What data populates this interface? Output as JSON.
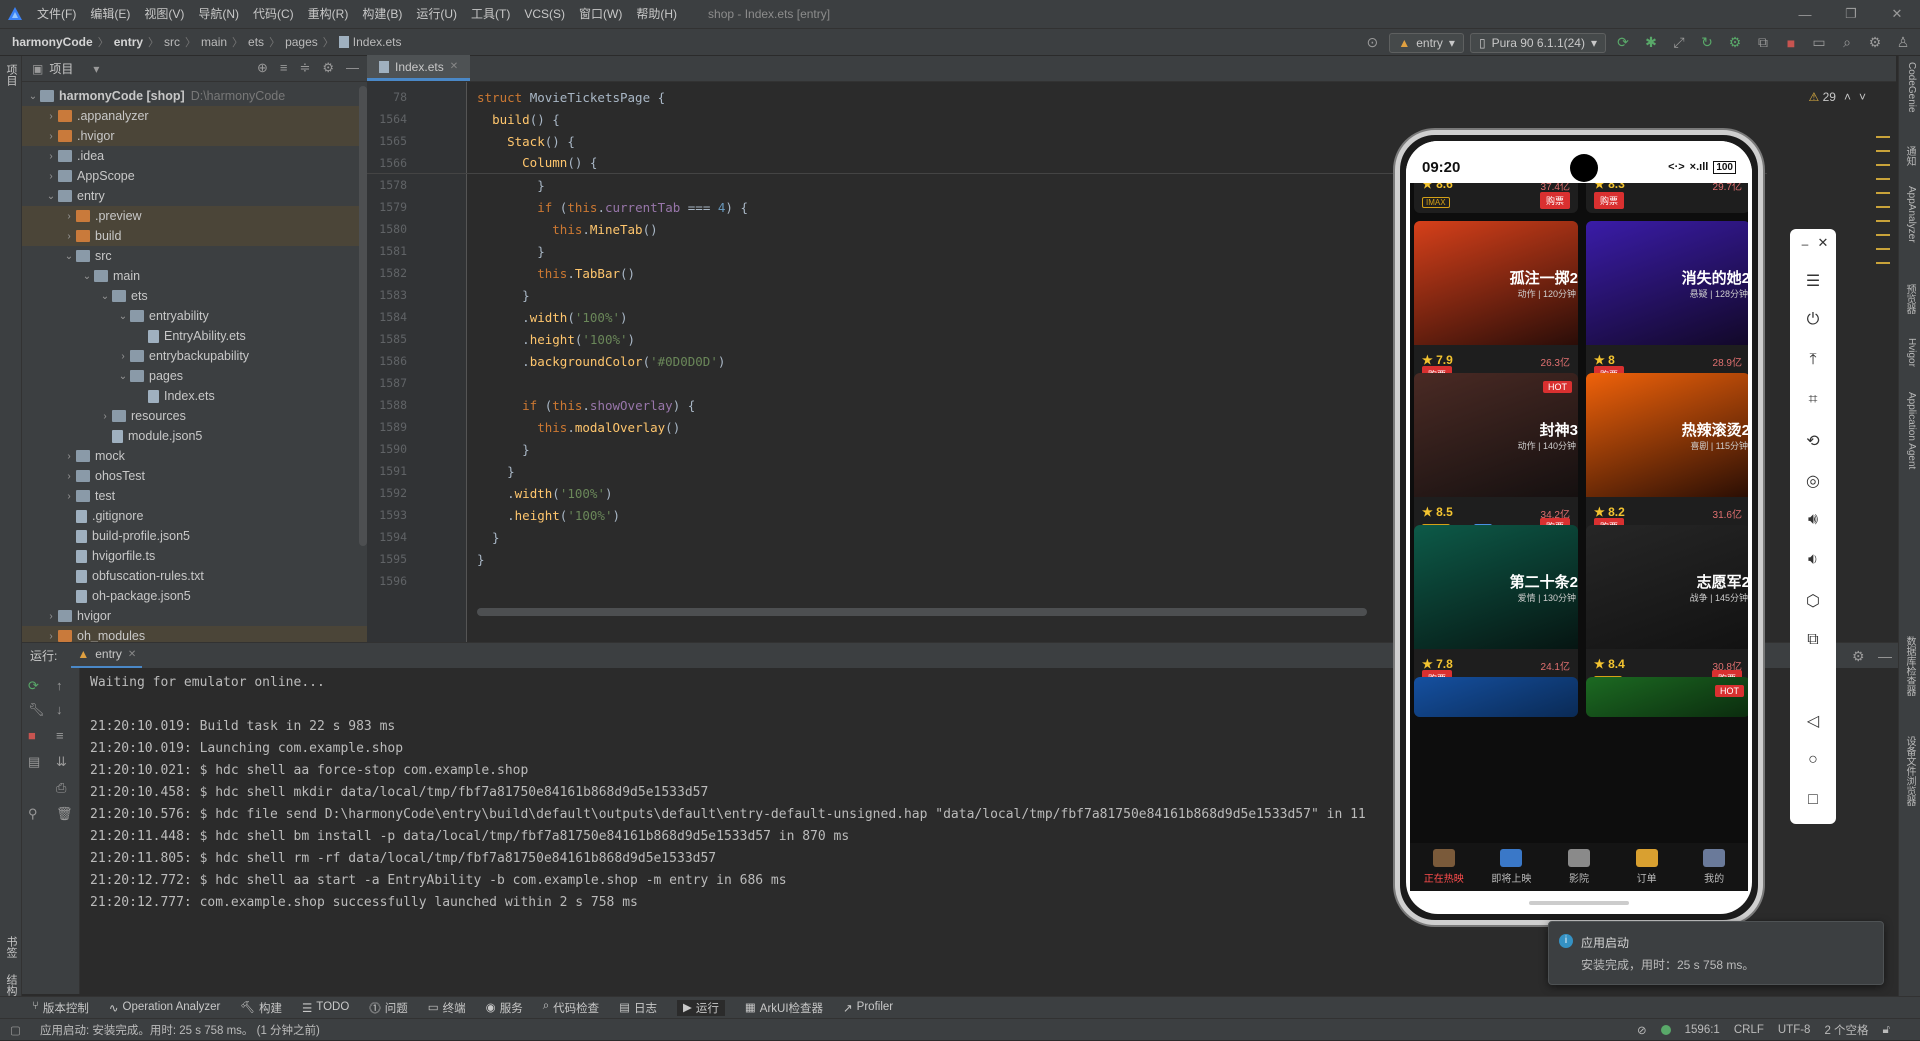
{
  "menubar": {
    "items": [
      "文件(F)",
      "编辑(E)",
      "视图(V)",
      "导航(N)",
      "代码(C)",
      "重构(R)",
      "构建(B)",
      "运行(U)",
      "工具(T)",
      "VCS(S)",
      "窗口(W)",
      "帮助(H)"
    ],
    "window_title": "shop - Index.ets [entry]"
  },
  "navbar": {
    "crumbs": [
      "harmonyCode",
      "entry",
      "src",
      "main",
      "ets",
      "pages",
      "Index.ets"
    ],
    "run_config": "entry",
    "device": "Pura 90 6.1.1(24)"
  },
  "left_strip": {
    "project_label": "项目",
    "bookmarks_label": "书签",
    "structure_label": "结构"
  },
  "right_strip": [
    "CodeGenie",
    "通知",
    "AppAnalyzer",
    "预览器",
    "Hvigor",
    "Application Agent",
    "数据库检查器",
    "设备文件浏览器"
  ],
  "project": {
    "title": "项目",
    "tree": [
      {
        "indent": 0,
        "arrow": "⌄",
        "type": "module",
        "label": "harmonyCode [shop]",
        "sub": "D:\\harmonyCode",
        "excluded": false
      },
      {
        "indent": 1,
        "arrow": "›",
        "type": "folder-orange",
        "label": ".appanalyzer",
        "excluded": true
      },
      {
        "indent": 1,
        "arrow": "›",
        "type": "folder-orange",
        "label": ".hvigor",
        "excluded": true
      },
      {
        "indent": 1,
        "arrow": "›",
        "type": "folder",
        "label": ".idea",
        "excluded": false
      },
      {
        "indent": 1,
        "arrow": "›",
        "type": "folder",
        "label": "AppScope",
        "excluded": false
      },
      {
        "indent": 1,
        "arrow": "⌄",
        "type": "folder",
        "label": "entry",
        "excluded": false
      },
      {
        "indent": 2,
        "arrow": "›",
        "type": "folder-orange",
        "label": ".preview",
        "excluded": true
      },
      {
        "indent": 2,
        "arrow": "›",
        "type": "folder-orange",
        "label": "build",
        "excluded": true
      },
      {
        "indent": 2,
        "arrow": "⌄",
        "type": "folder",
        "label": "src",
        "excluded": false
      },
      {
        "indent": 3,
        "arrow": "⌄",
        "type": "folder",
        "label": "main",
        "excluded": false
      },
      {
        "indent": 4,
        "arrow": "⌄",
        "type": "folder",
        "label": "ets",
        "excluded": false
      },
      {
        "indent": 5,
        "arrow": "⌄",
        "type": "folder",
        "label": "entryability",
        "excluded": false
      },
      {
        "indent": 6,
        "arrow": "",
        "type": "file",
        "label": "EntryAbility.ets",
        "excluded": false
      },
      {
        "indent": 5,
        "arrow": "›",
        "type": "folder",
        "label": "entrybackupability",
        "excluded": false
      },
      {
        "indent": 5,
        "arrow": "⌄",
        "type": "folder",
        "label": "pages",
        "excluded": false
      },
      {
        "indent": 6,
        "arrow": "",
        "type": "file",
        "label": "Index.ets",
        "excluded": false
      },
      {
        "indent": 4,
        "arrow": "›",
        "type": "folder",
        "label": "resources",
        "excluded": false
      },
      {
        "indent": 4,
        "arrow": "",
        "type": "file",
        "label": "module.json5",
        "excluded": false
      },
      {
        "indent": 2,
        "arrow": "›",
        "type": "folder",
        "label": "mock",
        "excluded": false
      },
      {
        "indent": 2,
        "arrow": "›",
        "type": "folder",
        "label": "ohosTest",
        "excluded": false
      },
      {
        "indent": 2,
        "arrow": "›",
        "type": "folder",
        "label": "test",
        "excluded": false
      },
      {
        "indent": 2,
        "arrow": "",
        "type": "file",
        "label": ".gitignore",
        "excluded": false
      },
      {
        "indent": 2,
        "arrow": "",
        "type": "file",
        "label": "build-profile.json5",
        "excluded": false
      },
      {
        "indent": 2,
        "arrow": "",
        "type": "file",
        "label": "hvigorfile.ts",
        "excluded": false
      },
      {
        "indent": 2,
        "arrow": "",
        "type": "file",
        "label": "obfuscation-rules.txt",
        "excluded": false
      },
      {
        "indent": 2,
        "arrow": "",
        "type": "file",
        "label": "oh-package.json5",
        "excluded": false
      },
      {
        "indent": 1,
        "arrow": "›",
        "type": "folder",
        "label": "hvigor",
        "excluded": false
      },
      {
        "indent": 1,
        "arrow": "›",
        "type": "folder-orange",
        "label": "oh_modules",
        "excluded": true
      }
    ]
  },
  "editor": {
    "tab": "Index.ets",
    "warnings": "29",
    "lines": [
      {
        "n": "78",
        "html": "<span class=\"kw\">struct</span> <span class=\"cls\">MovieTicketsPage</span> {",
        "sticky": false
      },
      {
        "n": "1564",
        "html": "  <span class=\"fn\">build</span>() {",
        "sticky": false
      },
      {
        "n": "1565",
        "html": "    <span class=\"fn\">Stack</span>() {",
        "sticky": false
      },
      {
        "n": "1566",
        "html": "      <span class=\"fn\">Column</span>() {",
        "sticky": true
      },
      {
        "n": "1578",
        "html": "        }",
        "sticky": false
      },
      {
        "n": "1579",
        "html": "        <span class=\"kw\">if</span> (<span class=\"kw\">this</span>.<span class=\"purple\">currentTab</span> === <span class=\"num\">4</span>) {",
        "sticky": false
      },
      {
        "n": "1580",
        "html": "          <span class=\"kw\">this</span>.<span class=\"fn\">MineTab</span>()",
        "sticky": false
      },
      {
        "n": "1581",
        "html": "        }",
        "sticky": false
      },
      {
        "n": "1582",
        "html": "        <span class=\"kw\">this</span>.<span class=\"fn\">TabBar</span>()",
        "sticky": false
      },
      {
        "n": "1583",
        "html": "      }",
        "sticky": false
      },
      {
        "n": "1584",
        "html": "      .<span class=\"fn\">width</span>(<span class=\"str\">'100%'</span>)",
        "sticky": false
      },
      {
        "n": "1585",
        "html": "      .<span class=\"fn\">height</span>(<span class=\"str\">'100%'</span>)",
        "sticky": false
      },
      {
        "n": "1586",
        "html": "      .<span class=\"fn\">backgroundColor</span>(<span class=\"str\">'#0D0D0D'</span>)",
        "sticky": false
      },
      {
        "n": "1587",
        "html": "",
        "sticky": false
      },
      {
        "n": "1588",
        "html": "      <span class=\"kw\">if</span> (<span class=\"kw\">this</span>.<span class=\"purple\">showOverlay</span>) {",
        "sticky": false
      },
      {
        "n": "1589",
        "html": "        <span class=\"kw\">this</span>.<span class=\"fn\">modalOverlay</span>()",
        "sticky": false
      },
      {
        "n": "1590",
        "html": "      }",
        "sticky": false
      },
      {
        "n": "1591",
        "html": "    }",
        "sticky": false
      },
      {
        "n": "1592",
        "html": "    .<span class=\"fn\">width</span>(<span class=\"str\">'100%'</span>)",
        "sticky": false
      },
      {
        "n": "1593",
        "html": "    .<span class=\"fn\">height</span>(<span class=\"str\">'100%'</span>)",
        "sticky": false
      },
      {
        "n": "1594",
        "html": "  }",
        "sticky": false
      },
      {
        "n": "1595",
        "html": "}",
        "sticky": false
      },
      {
        "n": "1596",
        "html": "",
        "sticky": false
      }
    ]
  },
  "run_panel": {
    "label": "运行:",
    "tab": "entry",
    "console": [
      "Waiting for emulator online...",
      "",
      "21:20:10.019: Build task in 22 s 983 ms",
      "21:20:10.019: Launching com.example.shop",
      "21:20:10.021: $ hdc shell aa force-stop com.example.shop",
      "21:20:10.458: $ hdc shell mkdir data/local/tmp/fbf7a81750e84161b868d9d5e1533d57",
      "21:20:10.576: $ hdc file send D:\\harmonyCode\\entry\\build\\default\\outputs\\default\\entry-default-unsigned.hap \"data/local/tmp/fbf7a81750e84161b868d9d5e1533d57\" in 11",
      "21:20:11.448: $ hdc shell bm install -p data/local/tmp/fbf7a81750e84161b868d9d5e1533d57 in 870 ms",
      "21:20:11.805: $ hdc shell rm -rf data/local/tmp/fbf7a81750e84161b868d9d5e1533d57",
      "21:20:12.772: $ hdc shell aa start -a EntryAbility -b com.example.shop -m entry in 686 ms",
      "21:20:12.777: com.example.shop successfully launched within 2 s 758 ms"
    ]
  },
  "bottom_tools": [
    "版本控制",
    "Operation Analyzer",
    "构建",
    "TODO",
    "问题",
    "终端",
    "服务",
    "代码检查",
    "日志",
    "运行",
    "ArkUI检查器",
    "Profiler"
  ],
  "statusbar": {
    "message": "应用启动: 安装完成。用时: 25 s 758 ms。 (1 分钟之前)",
    "position": "1596:1",
    "line_sep": "CRLF",
    "encoding": "UTF-8",
    "indent": "2 个空格"
  },
  "notification": {
    "title": "应用启动",
    "body": "安装完成，用时：25 s 758 ms。"
  },
  "phone": {
    "time": "09:20",
    "battery": "100",
    "top_cards": [
      {
        "rating": "★ 8.6",
        "box": "37.4亿",
        "tag": "IMAX",
        "buy": "购票"
      },
      {
        "rating": "★ 8.3",
        "box": "29.7亿",
        "buy": "购票"
      }
    ],
    "cards": [
      {
        "title": "孤注一掷2",
        "sub": "动作 | 120分钟",
        "rating": "★ 7.9",
        "box": "26.3亿",
        "buy": "购票",
        "hot": "",
        "tags": [],
        "colors": [
          "#d6401a",
          "#2a0d08"
        ]
      },
      {
        "title": "消失的她2",
        "sub": "悬疑 | 128分钟",
        "rating": "★ 8",
        "box": "28.9亿",
        "buy": "购票",
        "hot": "",
        "tags": [],
        "colors": [
          "#3a1ca8",
          "#120828"
        ]
      },
      {
        "title": "封神3",
        "sub": "动作 | 140分钟",
        "rating": "★ 8.5",
        "box": "34.2亿",
        "buy": "购票",
        "hot": "HOT",
        "tags": [
          "IMAX",
          "3D"
        ],
        "colors": [
          "#4a2a24",
          "#151010"
        ]
      },
      {
        "title": "热辣滚烫2",
        "sub": "喜剧 | 115分钟",
        "rating": "★ 8.2",
        "box": "31.6亿",
        "buy": "购票",
        "hot": "",
        "tags": [],
        "colors": [
          "#f0620a",
          "#2a0e04"
        ]
      },
      {
        "title": "第二十条2",
        "sub": "爱情 | 130分钟",
        "rating": "★ 7.8",
        "box": "24.1亿",
        "buy": "购票",
        "hot": "",
        "tags": [],
        "colors": [
          "#0d5a48",
          "#061512"
        ]
      },
      {
        "title": "志愿军2",
        "sub": "战争 | 145分钟",
        "rating": "★ 8.4",
        "box": "30.8亿",
        "buy": "购票",
        "hot": "",
        "tags": [
          "IMAX"
        ],
        "colors": [
          "#262626",
          "#121212"
        ]
      }
    ],
    "bottom_cards": [
      {
        "hot": "",
        "colors": [
          "#1550a0",
          "#0a2a55"
        ]
      },
      {
        "hot": "HOT",
        "colors": [
          "#1c6a22",
          "#0b2c0e"
        ]
      }
    ],
    "tabs": [
      {
        "label": "正在热映",
        "active": true,
        "color": "#7a5a3a"
      },
      {
        "label": "即将上映",
        "active": false,
        "color": "#3a78c8"
      },
      {
        "label": "影院",
        "active": false,
        "color": "#8a8a8a"
      },
      {
        "label": "订单",
        "active": false,
        "color": "#d9a030"
      },
      {
        "label": "我的",
        "active": false,
        "color": "#6a7a9a"
      }
    ]
  }
}
